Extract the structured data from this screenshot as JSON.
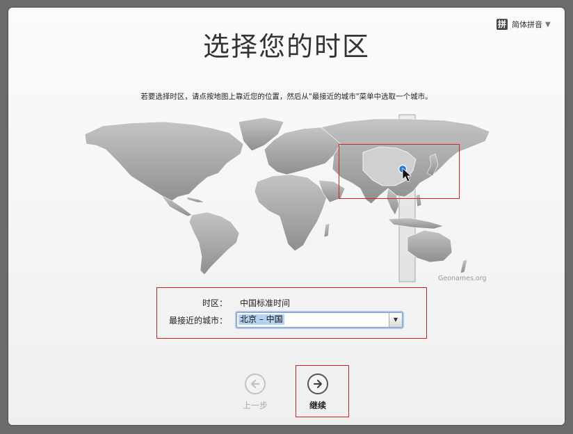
{
  "window": {
    "title": "选择您的时区",
    "instruction": "若要选择时区，请点按地图上靠近您的位置，然后从\"最接近的城市\"菜单中选取一个城市。"
  },
  "input_menu": {
    "icon_text": "拼",
    "label": "简体拼音"
  },
  "map": {
    "credit": "Geonames.org",
    "land_color": "#9d9d9d",
    "selected_zone_color": "#cfcfcf",
    "pin_color": "#2f7bd8",
    "highlight_color": "#d21f1f"
  },
  "timezone": {
    "label": "时区：",
    "value": "中国标准时间"
  },
  "city": {
    "label": "最接近的城市：",
    "selected": "北京 – 中国"
  },
  "nav": {
    "back_label": "上一步",
    "continue_label": "继续"
  }
}
